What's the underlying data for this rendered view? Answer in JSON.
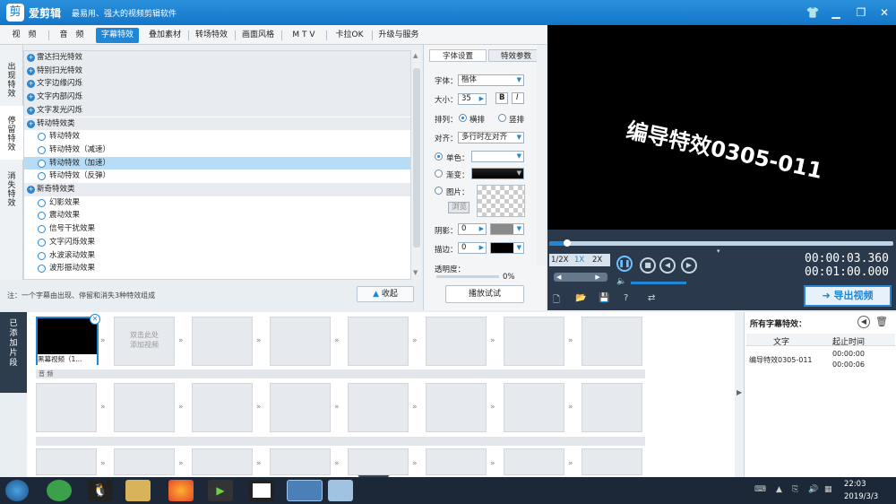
{
  "app": {
    "logo": "剪",
    "name": "爱剪辑",
    "slogan": "最易用、强大的视频剪辑软件"
  },
  "tabs": [
    "视　频",
    "音　频",
    "字幕特效",
    "叠加素材",
    "转场特效",
    "画面风格",
    "M T V",
    "卡拉OK",
    "升级与服务"
  ],
  "side_tabs": [
    "出现特效",
    "停留特效",
    "消失特效"
  ],
  "effects": [
    {
      "label": "雷达扫光特效",
      "kind": "cat"
    },
    {
      "label": "特别扫光特效",
      "kind": "cat"
    },
    {
      "label": "文字边缘闪烁",
      "kind": "cat"
    },
    {
      "label": "文字内部闪烁",
      "kind": "cat"
    },
    {
      "label": "文字发光闪烁",
      "kind": "cat"
    },
    {
      "label": "转动特效类",
      "kind": "cat"
    },
    {
      "label": "转动特效",
      "kind": "item"
    },
    {
      "label": "转动特效（减速）",
      "kind": "item"
    },
    {
      "label": "转动特效（加速）",
      "kind": "sel"
    },
    {
      "label": "转动特效（反弹）",
      "kind": "item"
    },
    {
      "label": "新奇特效类",
      "kind": "cat"
    },
    {
      "label": "幻影效果",
      "kind": "item"
    },
    {
      "label": "震动效果",
      "kind": "item"
    },
    {
      "label": "信号干扰效果",
      "kind": "item"
    },
    {
      "label": "文字闪烁效果",
      "kind": "item"
    },
    {
      "label": "水波滚动效果",
      "kind": "item"
    },
    {
      "label": "波形振动效果",
      "kind": "item"
    }
  ],
  "note": "注：一个字幕由出现、停留和消失3种特效组成",
  "collapse_label": "收起",
  "settings": {
    "tab_font": "字体设置",
    "tab_params": "特效参数",
    "font_label": "字体：",
    "font_value": "楷体",
    "size_label": "大小：",
    "size_value": "35",
    "bold": "B",
    "italic": "I",
    "layout_label": "排列：",
    "horizontal": "横排",
    "vertical": "竖排",
    "align_label": "对齐：",
    "align_value": "多行时左对齐",
    "solid_label": "单色：",
    "gradient_label": "渐变：",
    "image_label": "图片：",
    "browse_label": "浏览",
    "shadow_label": "阴影：",
    "shadow_value": "0",
    "stroke_label": "描边：",
    "stroke_value": "0",
    "opacity_label": "透明度：",
    "opacity_value": "0%",
    "preview_button": "播放试试"
  },
  "preview": {
    "text": "编导特效0305-011"
  },
  "player": {
    "speed_half": "1/2X",
    "speed_1x": "1X",
    "speed_2x": "2X",
    "time_current": "00:00:03.360",
    "time_total": "00:01:00.000",
    "progress": 0.05
  },
  "export_label": "导出视频",
  "added_label": "已添加片段",
  "clips": {
    "first_caption": "黑幕视频（1...",
    "placeholder": "双击此处\n添加视频",
    "audio_lane": "音 频"
  },
  "subtitle_panel": {
    "title": "所有字幕特效：",
    "col_text": "文字",
    "col_time": "起止时间",
    "row_text": "编导特效0305-011",
    "row_start": "00:00:00",
    "row_end": "00:00:06"
  },
  "taskbar": {
    "time": "22:03",
    "date": "2019/3/3"
  },
  "colors": {
    "accent": "#1f87d6",
    "titlebar": "#1476c9",
    "selected_row": "#b8dcf5"
  }
}
